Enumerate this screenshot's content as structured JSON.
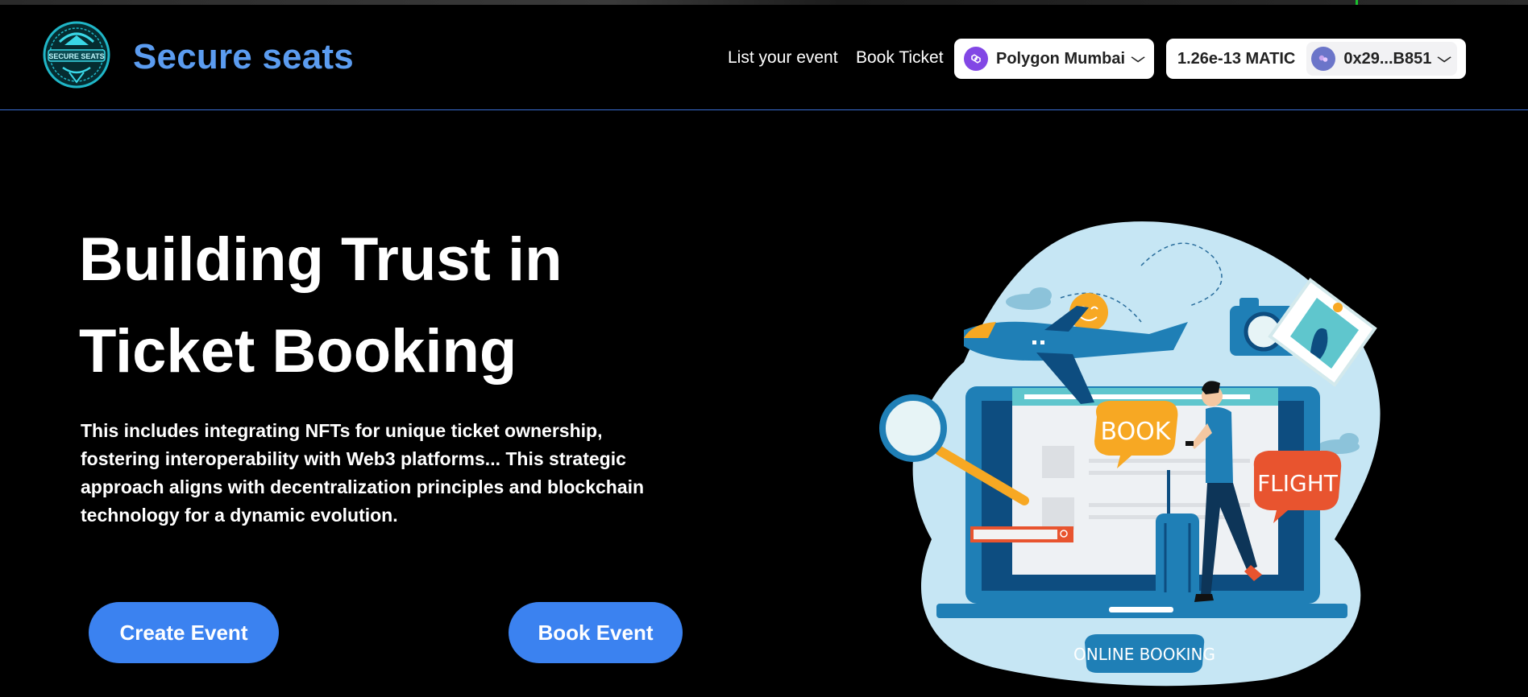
{
  "header": {
    "brand": "Secure seats",
    "logo_text": "SECURE SEATS",
    "nav": {
      "list_event": "List your event",
      "book_ticket": "Book Ticket"
    },
    "network": {
      "label": "Polygon Mumbai",
      "icon": "polygon-icon"
    },
    "wallet": {
      "balance": "1.26e-13 MATIC",
      "address": "0x29...B851"
    }
  },
  "hero": {
    "title_line1": "Building Trust in",
    "title_line2": "Ticket Booking",
    "description": "This includes integrating NFTs for unique ticket ownership, fostering interoperability with Web3 platforms... This strategic approach aligns with decentralization principles and blockchain technology for a dynamic evolution.",
    "create_button": "Create Event",
    "book_button": "Book Event"
  },
  "illustration": {
    "book_bubble": "BOOK",
    "flight_bubble": "FLIGHT",
    "banner": "ONLINE BOOKING"
  },
  "colors": {
    "accent": "#3b82f0",
    "brand": "#5b9cf0",
    "polygon": "#8247e5"
  }
}
